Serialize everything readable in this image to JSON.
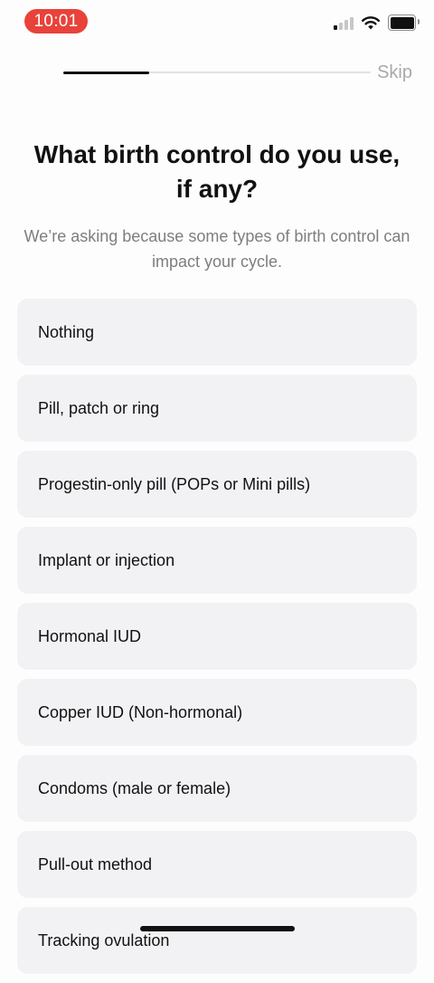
{
  "status_bar": {
    "time": "10:01",
    "time_pill_color": "#e8423a",
    "signal_bars_active": 1,
    "signal_bars_total": 4,
    "wifi_icon": "wifi-icon",
    "battery_icon": "battery-icon",
    "battery_level": 1.0
  },
  "header": {
    "progress": 0.28,
    "skip_label": "Skip"
  },
  "question": {
    "title": "What birth control do you use, if any?",
    "subtitle": "We’re asking because some types of birth control can impact your cycle."
  },
  "options": [
    {
      "label": "Nothing"
    },
    {
      "label": "Pill, patch or ring"
    },
    {
      "label": "Progestin-only pill (POPs or Mini pills)"
    },
    {
      "label": "Implant or injection"
    },
    {
      "label": "Hormonal IUD"
    },
    {
      "label": "Copper IUD (Non-hormonal)"
    },
    {
      "label": "Condoms (male or female)"
    },
    {
      "label": "Pull-out method"
    },
    {
      "label": "Tracking ovulation"
    }
  ],
  "colors": {
    "option_background": "#f2f2f4",
    "accent": "#111111",
    "muted_text": "#7e7e82"
  }
}
